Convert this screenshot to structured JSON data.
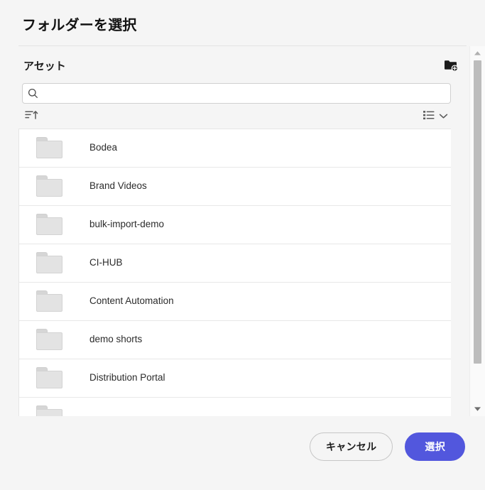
{
  "dialog": {
    "title": "フォルダーを選択"
  },
  "picker": {
    "rail_label": "アセット",
    "new_folder_icon": "new-folder-icon",
    "search": {
      "value": "",
      "placeholder": "",
      "icon": "search-icon"
    },
    "toolbar": {
      "sort_icon": "sort-ascending-icon",
      "view_icon": "list-view-icon",
      "view_chevron_icon": "chevron-down-icon"
    },
    "folders": [
      {
        "name": "Bodea",
        "icon": "folder-icon"
      },
      {
        "name": "Brand Videos",
        "icon": "folder-icon"
      },
      {
        "name": "bulk-import-demo",
        "icon": "folder-icon"
      },
      {
        "name": "CI-HUB",
        "icon": "folder-icon"
      },
      {
        "name": "Content Automation",
        "icon": "folder-icon"
      },
      {
        "name": "demo shorts",
        "icon": "folder-icon"
      },
      {
        "name": "Distribution Portal",
        "icon": "folder-icon"
      }
    ],
    "scrollbar": {
      "up_icon": "scroll-up-arrow-icon",
      "down_icon": "scroll-down-arrow-icon"
    }
  },
  "footer": {
    "cancel_label": "キャンセル",
    "confirm_label": "選択"
  },
  "colors": {
    "accent": "#5257dd",
    "background": "#f5f5f5",
    "surface": "#ffffff",
    "border": "#e6e6e6",
    "text": "#2c2c2c"
  }
}
